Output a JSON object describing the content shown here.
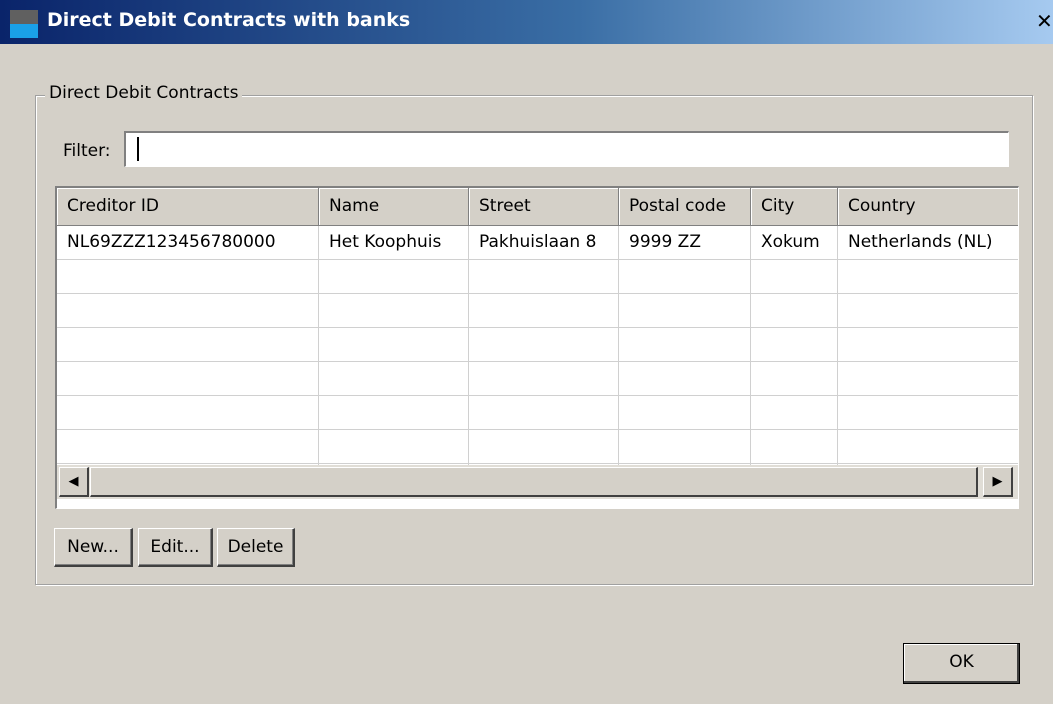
{
  "window": {
    "title": "Direct Debit Contracts with banks",
    "close_glyph": "✕"
  },
  "group": {
    "title": "Direct Debit Contracts"
  },
  "filter": {
    "label": "Filter:",
    "value": ""
  },
  "table": {
    "columns": [
      "Creditor ID",
      "Name",
      "Street",
      "Postal code",
      "City",
      "Country"
    ],
    "rows": [
      [
        "NL69ZZZ123456780000",
        "Het Koophuis",
        "Pakhuislaan 8",
        "9999 ZZ",
        "Xokum",
        "Netherlands (NL)"
      ]
    ]
  },
  "scrollbar": {
    "left_glyph": "◀",
    "right_glyph": "▶"
  },
  "buttons": {
    "new": "New...",
    "edit": "Edit...",
    "delete": "Delete",
    "ok": "OK"
  }
}
